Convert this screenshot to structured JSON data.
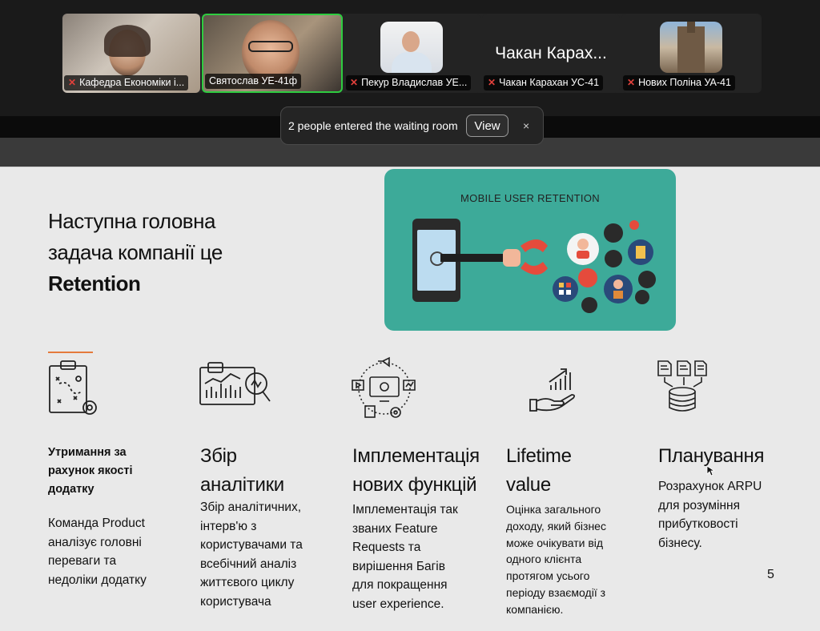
{
  "meeting": {
    "participants": [
      {
        "name": "Кафедра Економіки і...",
        "muted": true
      },
      {
        "name": "Святослав УЕ-41ф",
        "muted": false
      },
      {
        "name": "Пекур Владислав УЕ...",
        "muted": true
      },
      {
        "name": "Чакан Карахан УС-41",
        "muted": true,
        "display_name": "Чакан Карах..."
      },
      {
        "name": "Нових Поліна УА-41",
        "muted": true
      }
    ],
    "active_speaker_color": "#2ecc40",
    "muted_icon_color": "#e0403b",
    "icons": {
      "muted": "mic-off-icon",
      "close": "close-icon"
    }
  },
  "notification": {
    "message": "2 people entered the waiting room",
    "view_label": "View",
    "close_label": "×"
  },
  "slide": {
    "headline_line1": "Наступна головна",
    "headline_line2": "задача компанії це",
    "headline_bold": "Retention",
    "banner_title": "MOBILE USER RETENTION",
    "banner_color": "#3daa99",
    "accent_color": "#e47a3c",
    "page_number": "5",
    "columns": [
      {
        "icon": "strategy-clipboard-icon",
        "title_lines": [
          "Утримання за",
          "рахунок якості",
          "додатку"
        ],
        "body_lines": [
          "Команда Product",
          "аналізує головні",
          "переваги та",
          "недоліки додатку"
        ]
      },
      {
        "icon": "analytics-magnifier-icon",
        "title_lines": [
          "Збір",
          "аналітики"
        ],
        "body_lines": [
          "Збір аналітичних,",
          "інтерв'ю з",
          "користувачами та",
          "всебічний аналіз",
          "життєвого циклу",
          "користувача"
        ]
      },
      {
        "icon": "feature-implementation-icon",
        "title_lines": [
          "Імплементація",
          "нових функцій"
        ],
        "body_lines": [
          "Імплементація так",
          "званих Feature",
          "Requests та",
          "вирішення Багів",
          "для покращення",
          "user experience."
        ]
      },
      {
        "icon": "growth-hand-icon",
        "title_lines": [
          "Lifetime",
          "value"
        ],
        "body_lines": [
          "Оцінка загального",
          "доходу, який бізнес",
          "може очікувати від",
          "одного клієнта",
          "протягом усього",
          "періоду взаємодії з",
          "компанією."
        ]
      },
      {
        "icon": "database-planning-icon",
        "title_lines": [
          "Планування"
        ],
        "body_lines": [
          "Розрахунок ARPU",
          "для розуміння",
          "прибутковості",
          "бізнесу."
        ]
      }
    ]
  }
}
